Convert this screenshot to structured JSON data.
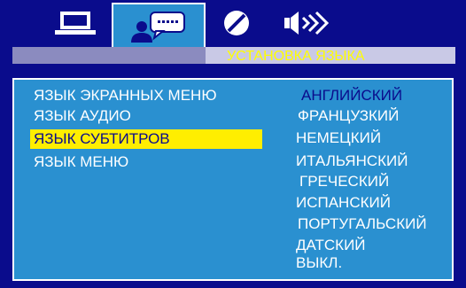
{
  "colors": {
    "background": "#0a0c8c",
    "panel": "#2a90d0",
    "highlight": "#ffee00",
    "title_text": "#ffff00",
    "text": "#ffffff",
    "current_option": "#0a0c8c"
  },
  "tabs": [
    {
      "icon": "monitor-icon",
      "active": false
    },
    {
      "icon": "person-speech-icon",
      "active": true
    },
    {
      "icon": "disc-icon",
      "active": false
    },
    {
      "icon": "speaker-icon",
      "active": false
    }
  ],
  "header": {
    "title": "УСТАНОВКА ЯЗЫКА"
  },
  "menu": {
    "items": [
      "ЯЗЫК ЭКРАННЫХ МЕНЮ",
      "ЯЗЫК АУДИО",
      "ЯЗЫК СУБТИТРОВ",
      "ЯЗЫК МЕНЮ"
    ],
    "selected_index": 2
  },
  "options": {
    "items": [
      "АНГЛИЙСКИЙ",
      "ФРАНЦУЗКИЙ",
      "НЕМЕЦКИЙ",
      "ИТАЛЬЯНСКИЙ",
      "ГРЕЧЕСКИЙ",
      "ИСПАНСКИЙ",
      "ПОРТУГАЛЬСКИЙ",
      "ДАТСКИЙ",
      "ВЫКЛ."
    ],
    "current_index": 0
  }
}
